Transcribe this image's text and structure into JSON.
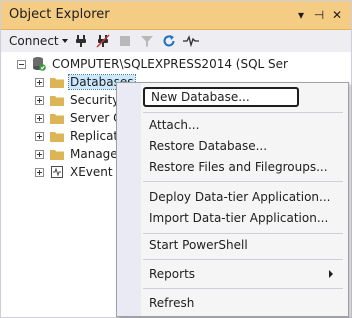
{
  "panel": {
    "title": "Object Explorer",
    "controls": {
      "dropdown": "▾",
      "pin": "⊣",
      "close": "✕"
    }
  },
  "toolbar": {
    "connect_label": "Connect",
    "icons": [
      "connect-plug-icon",
      "disconnect-plug-icon",
      "stop-icon",
      "filter-icon",
      "refresh-icon",
      "activity-icon"
    ]
  },
  "tree": {
    "server": "COMPUTER\\SQLEXPRESS2014 (SQL Ser",
    "children": [
      {
        "label": "Databases",
        "selected": true
      },
      {
        "label": "Security"
      },
      {
        "label": "Server O"
      },
      {
        "label": "Replicat"
      },
      {
        "label": "Manage"
      },
      {
        "label": "XEvent P"
      }
    ]
  },
  "context_menu": {
    "items": [
      {
        "label": "New Database...",
        "highlighted": true
      },
      {
        "label": "Attach..."
      },
      {
        "label": "Restore Database..."
      },
      {
        "label": "Restore Files and Filegroups..."
      },
      {
        "label": "Deploy Data-tier Application..."
      },
      {
        "label": "Import Data-tier Application..."
      },
      {
        "label": "Start PowerShell"
      },
      {
        "label": "Reports",
        "has_submenu": true
      },
      {
        "label": "Refresh"
      }
    ]
  },
  "colors": {
    "title_bar": "#f5cc84",
    "selection": "#cce8ff",
    "menu_bg": "#f5f5f5",
    "server_icon_green": "#3c9a3c",
    "folder_yellow": "#dcb656",
    "refresh_blue": "#1e6fbf"
  }
}
